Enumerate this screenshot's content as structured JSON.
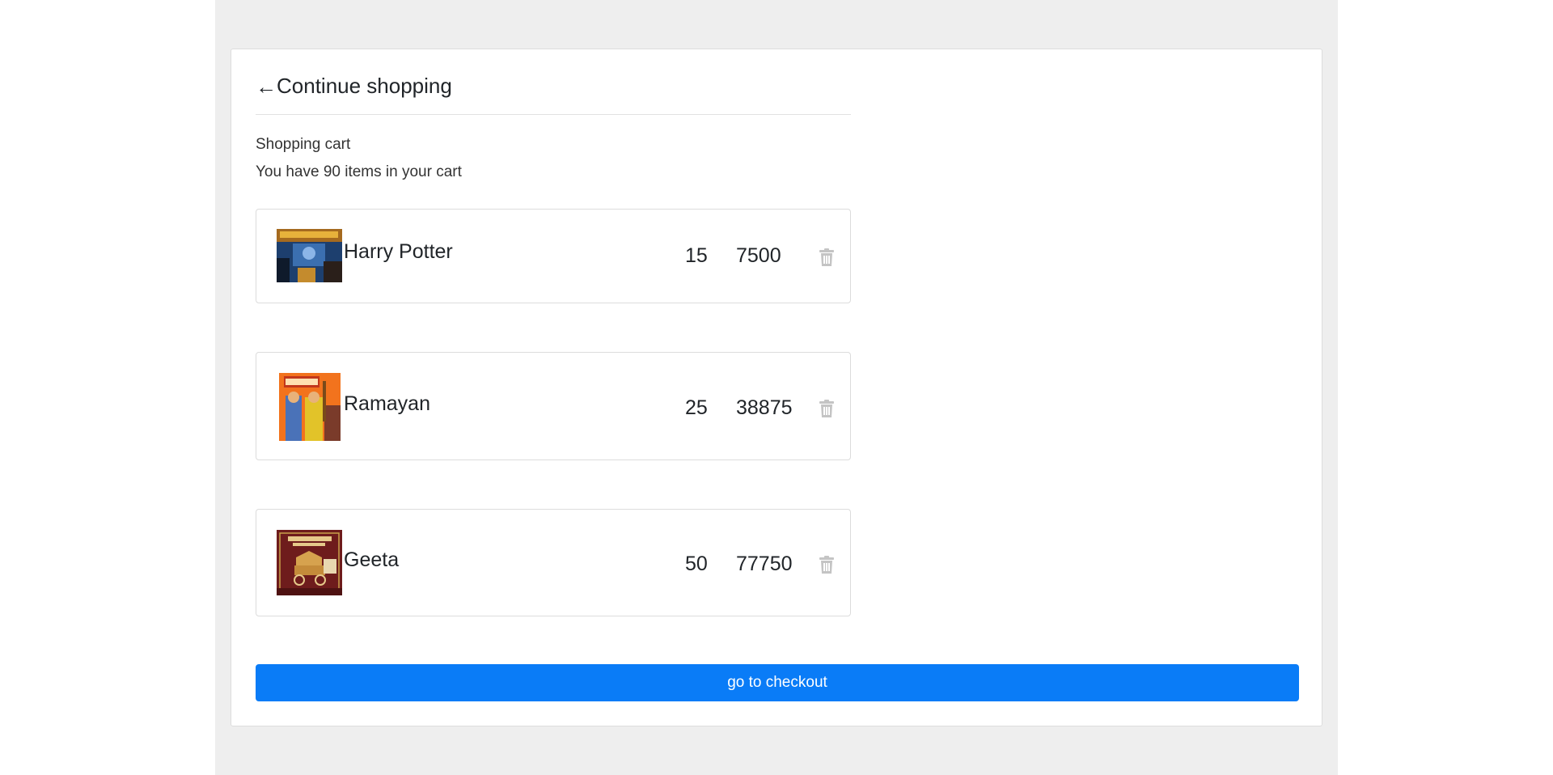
{
  "nav": {
    "back_arrow": "←",
    "back_label": "Continue shopping"
  },
  "cart": {
    "title": "Shopping cart",
    "summary": "You have 90 items in your cart",
    "items": [
      {
        "name": "Harry Potter",
        "qty": "15",
        "price": "7500"
      },
      {
        "name": "Ramayan",
        "qty": "25",
        "price": "38875"
      },
      {
        "name": "Geeta",
        "qty": "50",
        "price": "77750"
      }
    ]
  },
  "checkout": {
    "label": "go to checkout"
  },
  "colors": {
    "accent": "#0a7cf7",
    "page_background": "#eeeeee",
    "trash_icon": "#c4c4c4"
  }
}
